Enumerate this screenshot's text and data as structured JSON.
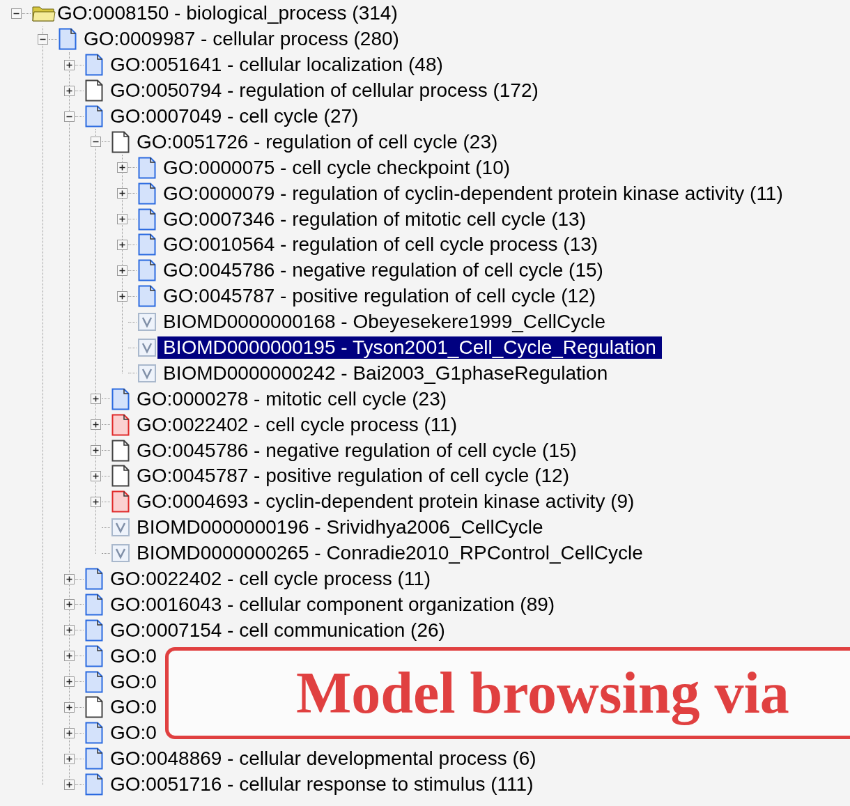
{
  "tree": [
    {
      "kind": "folder",
      "label": "GO:0008150 - biological_process (314)",
      "expanded": true,
      "selected": false,
      "children": [
        {
          "kind": "blue",
          "label": "GO:0009987 - cellular process (280)",
          "expanded": true,
          "selected": false,
          "children": [
            {
              "kind": "blue",
              "label": "GO:0051641 - cellular localization (48)",
              "expanded": false,
              "selected": false
            },
            {
              "kind": "white",
              "label": "GO:0050794 - regulation of cellular process (172)",
              "expanded": false,
              "selected": false
            },
            {
              "kind": "blue",
              "label": "GO:0007049 - cell cycle (27)",
              "expanded": true,
              "selected": false,
              "children": [
                {
                  "kind": "white",
                  "label": "GO:0051726 - regulation of cell cycle (23)",
                  "expanded": true,
                  "selected": false,
                  "children": [
                    {
                      "kind": "blue",
                      "label": "GO:0000075 - cell cycle checkpoint (10)",
                      "expanded": false,
                      "selected": false
                    },
                    {
                      "kind": "blue",
                      "label": "GO:0000079 - regulation of cyclin-dependent protein kinase activity (11)",
                      "expanded": false,
                      "selected": false
                    },
                    {
                      "kind": "blue",
                      "label": "GO:0007346 - regulation of mitotic cell cycle (13)",
                      "expanded": false,
                      "selected": false
                    },
                    {
                      "kind": "blue",
                      "label": "GO:0010564 - regulation of cell cycle process (13)",
                      "expanded": false,
                      "selected": false
                    },
                    {
                      "kind": "blue",
                      "label": "GO:0045786 - negative regulation of cell cycle (15)",
                      "expanded": false,
                      "selected": false
                    },
                    {
                      "kind": "blue",
                      "label": "GO:0045787 - positive regulation of cell cycle (12)",
                      "expanded": false,
                      "selected": false
                    },
                    {
                      "kind": "model",
                      "label": "BIOMD0000000168 - Obeyesekere1999_CellCycle",
                      "selected": false
                    },
                    {
                      "kind": "model",
                      "label": "BIOMD0000000195 - Tyson2001_Cell_Cycle_Regulation",
                      "selected": true
                    },
                    {
                      "kind": "model",
                      "label": "BIOMD0000000242 - Bai2003_G1phaseRegulation",
                      "selected": false
                    }
                  ]
                },
                {
                  "kind": "blue",
                  "label": "GO:0000278 - mitotic cell cycle (23)",
                  "expanded": false,
                  "selected": false
                },
                {
                  "kind": "red",
                  "label": "GO:0022402 - cell cycle process (11)",
                  "expanded": false,
                  "selected": false
                },
                {
                  "kind": "white",
                  "label": "GO:0045786 - negative regulation of cell cycle (15)",
                  "expanded": false,
                  "selected": false
                },
                {
                  "kind": "white",
                  "label": "GO:0045787 - positive regulation of cell cycle (12)",
                  "expanded": false,
                  "selected": false
                },
                {
                  "kind": "red",
                  "label": "GO:0004693 - cyclin-dependent protein kinase activity (9)",
                  "expanded": false,
                  "selected": false
                },
                {
                  "kind": "model",
                  "label": "BIOMD0000000196 - Srividhya2006_CellCycle",
                  "selected": false
                },
                {
                  "kind": "model",
                  "label": "BIOMD0000000265 - Conradie2010_RPControl_CellCycle",
                  "selected": false
                }
              ]
            },
            {
              "kind": "blue",
              "label": "GO:0022402 - cell cycle process (11)",
              "expanded": false,
              "selected": false
            },
            {
              "kind": "blue",
              "label": "GO:0016043 - cellular component organization (89)",
              "expanded": false,
              "selected": false
            },
            {
              "kind": "blue",
              "label": "GO:0007154 - cell communication (26)",
              "expanded": false,
              "selected": false
            },
            {
              "kind": "blue",
              "label": "GO:0",
              "expanded": false,
              "selected": false
            },
            {
              "kind": "blue",
              "label": "GO:0",
              "expanded": false,
              "selected": false
            },
            {
              "kind": "white",
              "label": "GO:0",
              "expanded": false,
              "selected": false
            },
            {
              "kind": "blue",
              "label": "GO:0",
              "expanded": false,
              "selected": false
            },
            {
              "kind": "blue",
              "label": "GO:0048869 - cellular developmental process (6)",
              "expanded": false,
              "selected": false
            },
            {
              "kind": "blue",
              "label": "GO:0051716 - cellular response to stimulus (111)",
              "expanded": false,
              "selected": false
            }
          ]
        }
      ]
    }
  ],
  "callout": {
    "text": "Model browsing via"
  }
}
